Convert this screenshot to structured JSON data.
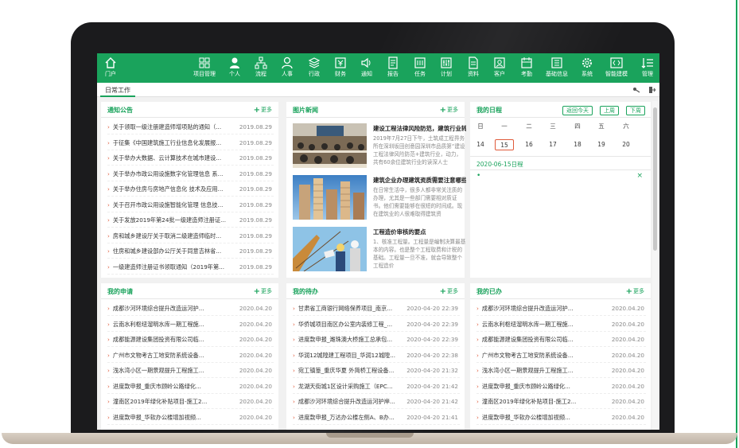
{
  "nav": {
    "items": [
      {
        "label": "门户",
        "icon": "home-icon"
      },
      {
        "label": "项目管理",
        "icon": "grid-icon"
      },
      {
        "label": "个人",
        "icon": "user-icon"
      },
      {
        "label": "流程",
        "icon": "flow-icon"
      },
      {
        "label": "人事",
        "icon": "person-icon"
      },
      {
        "label": "行政",
        "icon": "layers-icon"
      },
      {
        "label": "财务",
        "icon": "finance-icon"
      },
      {
        "label": "通知",
        "icon": "speaker-icon"
      },
      {
        "label": "报告",
        "icon": "report-icon"
      },
      {
        "label": "任务",
        "icon": "task-icon"
      },
      {
        "label": "计划",
        "icon": "plan-icon"
      },
      {
        "label": "资料",
        "icon": "file-icon"
      },
      {
        "label": "客户",
        "icon": "client-icon"
      },
      {
        "label": "考勤",
        "icon": "attendance-icon"
      },
      {
        "label": "基础信息",
        "icon": "info-icon"
      },
      {
        "label": "系统",
        "icon": "gear-icon"
      },
      {
        "label": "智能建模",
        "icon": "code-icon"
      },
      {
        "label": "管理",
        "icon": "manage-icon"
      }
    ]
  },
  "tabs": {
    "active": "日常工作"
  },
  "notice": {
    "title": "通知公告",
    "more": "更多",
    "items": [
      {
        "text": "关于领取一级注册建造师增项贴的通知（...",
        "date": "2019.08.29"
      },
      {
        "text": "于征集《中国建筑施工行业信息化发展报...",
        "date": "2019.08.29"
      },
      {
        "text": "关于举办大数据、云计算技术在城市建设...",
        "date": "2019.08.29"
      },
      {
        "text": "关于举办市政公用设施数字化管理信息 系...",
        "date": "2019.08.29"
      },
      {
        "text": "关于举办住房与房地产信息化 技术及应用...",
        "date": "2019.08.29"
      },
      {
        "text": "关于召开市政公用设施智能化管理 信息技...",
        "date": "2019.08.29"
      },
      {
        "text": "关于发放2019年第24批一级建造师注册证...",
        "date": "2019.08.29"
      },
      {
        "text": "房和城乡建设厅关于取消二级建造师临时...",
        "date": "2019.08.29"
      },
      {
        "text": "住房和城乡建设部办公厅关于同意吉林省...",
        "date": "2019.08.29"
      },
      {
        "text": "一级建造师注册证书领取通知（2019年第...",
        "date": "2019.08.29"
      }
    ]
  },
  "picnews": {
    "title": "图片新闻",
    "more": "更多",
    "items": [
      {
        "title": "建设工程法律风险防范，建筑行业转",
        "body": "2019年7月27日下午，土筑成工程界务所在深圳坂田创意园深圳市品质第“建设工程法律风险防范+建筑行业，动力，共有60余位建筑行业的读深人士"
      },
      {
        "title": "建筑企业办理建筑资质需要注意哪些",
        "body": "在日常生活中，很多人都非常关注质的办理，尤其是一些部门需要相对质证书。他们需要能够在很短的时间成。现在建筑业的人很难取得建筑资"
      },
      {
        "title": "工程造价审核的要点",
        "body": "1、核准工程量。工程量是编制决算最基本的内容。也是整个工程取费和计税的基础。工程量一旦不准，就会导致整个工程造价"
      }
    ]
  },
  "schedule": {
    "title": "我的日程",
    "btn_today": "返回今天",
    "btn_prev": "上周",
    "btn_next": "下周",
    "weekdays": [
      "日",
      "一",
      "二",
      "三",
      "四",
      "五",
      "六"
    ],
    "days": [
      "14",
      "15",
      "16",
      "17",
      "18",
      "19",
      "20"
    ],
    "selected": "15",
    "date_label": "2020-06-15日程",
    "close": "×",
    "dot": "•"
  },
  "apply": {
    "title": "我的申请",
    "more": "更多",
    "items": [
      {
        "text": "成都沙河环境综合提升改造运河护...",
        "date": "2020.04.20"
      },
      {
        "text": "云南水利枢纽溜明水库一期工程施...",
        "date": "2020.04.20"
      },
      {
        "text": "成都能源建设集团投资有限公司临...",
        "date": "2020.04.20"
      },
      {
        "text": "广州市文物考古工地安防系统设备...",
        "date": "2020.04.20"
      },
      {
        "text": "浅水湾小区一期景观提升工程施工...",
        "date": "2020.04.20"
      },
      {
        "text": "进度款申报_重庆市顾岭公路绿化...",
        "date": "2020.04.20"
      },
      {
        "text": "潼南区2019年绿化补贴项目-施工2...",
        "date": "2020.04.20"
      },
      {
        "text": "进度款申报_华软办公楼增加视频...",
        "date": "2020.04.20"
      }
    ]
  },
  "todo": {
    "title": "我的待办",
    "more": "更多",
    "items": [
      {
        "text": "甘肃省工商银行网络保养项目_南京...",
        "date": "2020-04-20 22:39"
      },
      {
        "text": "华侨城项目南区办公室内装修工程_...",
        "date": "2020-04-20 22:39"
      },
      {
        "text": "进度款申报_潍珠澳大桥施工总承包...",
        "date": "2020-04-20 22:39"
      },
      {
        "text": "华润12城隍建工程项目_华润12城隍...",
        "date": "2020-04-20 22:38"
      },
      {
        "text": "宛工镇篁_重庆华夏 外简桥工程设备...",
        "date": "2020-04-20 21:32"
      },
      {
        "text": "龙湖天街城1区设计采购施工（EPC...",
        "date": "2020-04-20 21:42"
      },
      {
        "text": "成都沙河环境综合提升改造运河护岸...",
        "date": "2020-04-20 21:42"
      },
      {
        "text": "进度款申报_万达办公楼左侧A、B办...",
        "date": "2020-04-20 21:41"
      }
    ]
  },
  "done": {
    "title": "我的已办",
    "more": "更多",
    "items": [
      {
        "text": "成都沙河环境综合提升改造运河护...",
        "date": "2020.04.20"
      },
      {
        "text": "云南水利枢纽溜明水库一期工程施...",
        "date": "2020.04.20"
      },
      {
        "text": "成都能源建设集团投资有限公司临...",
        "date": "2020.04.20"
      },
      {
        "text": "广州市文物考古工地安防系统设备...",
        "date": "2020.04.20"
      },
      {
        "text": "浅水湾小区一期景观提升工程施工...",
        "date": "2020.04.20"
      },
      {
        "text": "进度款申报_重庆市顾岭公路绿化...",
        "date": "2020.04.20"
      },
      {
        "text": "潼南区2019年绿化补贴项目-施工2...",
        "date": "2020.04.20"
      },
      {
        "text": "进度款申报_华软办公楼增加视频...",
        "date": "2020.04.20"
      }
    ]
  },
  "colors": {
    "accent": "#1aa35c",
    "arrow": "#e05a3a"
  }
}
